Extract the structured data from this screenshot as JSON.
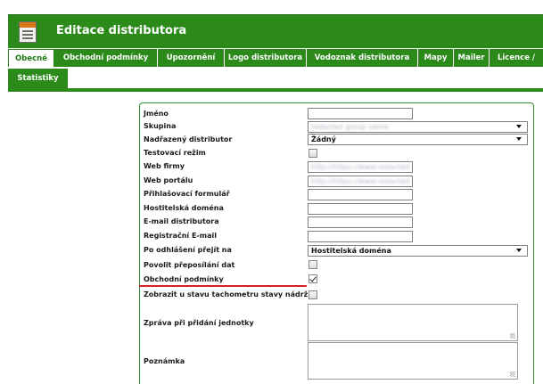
{
  "header": {
    "title": "Editace distributora",
    "icon": "document-icon"
  },
  "tabs": {
    "row1": [
      "Obecné",
      "Obchodní podmínky",
      "Upozornění",
      "Logo distributora",
      "Vodoznak distributora",
      "Mapy",
      "Mailer",
      "Licence /"
    ],
    "row2": [
      "Statistiky"
    ],
    "active": "Obecné"
  },
  "form": {
    "labels": {
      "jmeno": "Jméno",
      "skupina": "Skupina",
      "nadrazeny": "Nadřazený distributor",
      "testovaci": "Testovací režim",
      "web_firmy": "Web firmy",
      "web_portalu": "Web portálu",
      "prihlasovaci": "Přihlašovací formulář",
      "hostitelska": "Hostitelská doména",
      "email": "E-mail distributora",
      "registracni": "Registrační E-mail",
      "po_odhlaseni": "Po odhlášení přejít na",
      "povolit": "Povolit přeposílání dat",
      "obchodni": "Obchodní podmínky",
      "zobrazit": "Zobrazit u stavu tachometru stavy nádrží",
      "zprava": "Zpráva při přidání jednotky",
      "poznamka": "Poznámka"
    },
    "values": {
      "jmeno": "",
      "skupina": "redacted group name",
      "nadrazeny": "Žádný",
      "testovaci": false,
      "web_firmy": "http://https://www.redacted.cz/",
      "web_portalu": "http://https://www.redacted.cz/",
      "prihlasovaci": "",
      "hostitelska": "",
      "email": "",
      "registracni": "",
      "po_odhlaseni": "Hostitelská doména",
      "povolit": false,
      "obchodni": true,
      "zobrazit": false,
      "zprava": "",
      "poznamka": ""
    }
  },
  "colors": {
    "brand_green": "#2b8a1a",
    "accent_red": "#d0202a"
  }
}
